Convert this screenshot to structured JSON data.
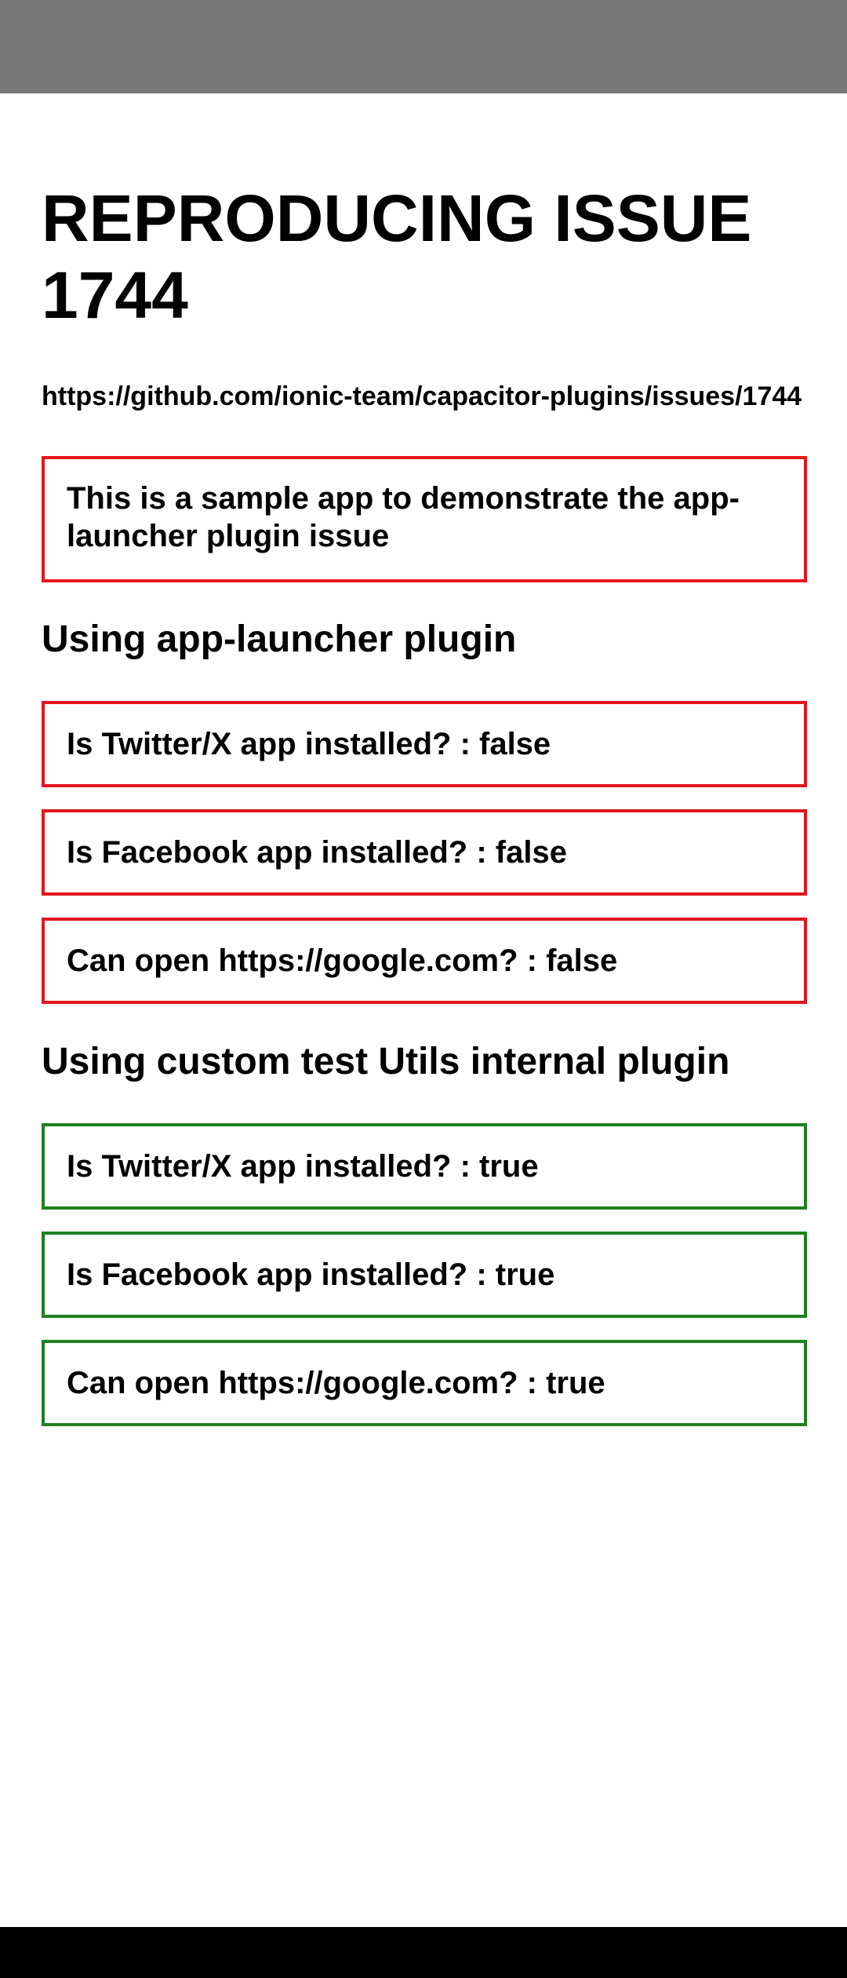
{
  "page": {
    "title": "REPRODUCING ISSUE 1744",
    "issue_link": "https://github.com/ionic-team/capacitor-plugins/issues/1744",
    "intro": "This is a sample app to demonstrate the app-launcher plugin issue"
  },
  "colors": {
    "status_bar": "#787878",
    "fail_border": "#e3141c",
    "pass_border": "#1f801f",
    "nav_bar": "#000000"
  },
  "sections": [
    {
      "heading": "Using app-launcher plugin",
      "results": [
        "Is Twitter/X app installed? : false",
        "Is Facebook app installed? : false",
        "Can open https://google.com? : false"
      ]
    },
    {
      "heading": "Using custom test Utils internal plugin",
      "results": [
        "Is Twitter/X app installed? : true",
        "Is Facebook app installed? : true",
        "Can open https://google.com? : true"
      ]
    }
  ]
}
